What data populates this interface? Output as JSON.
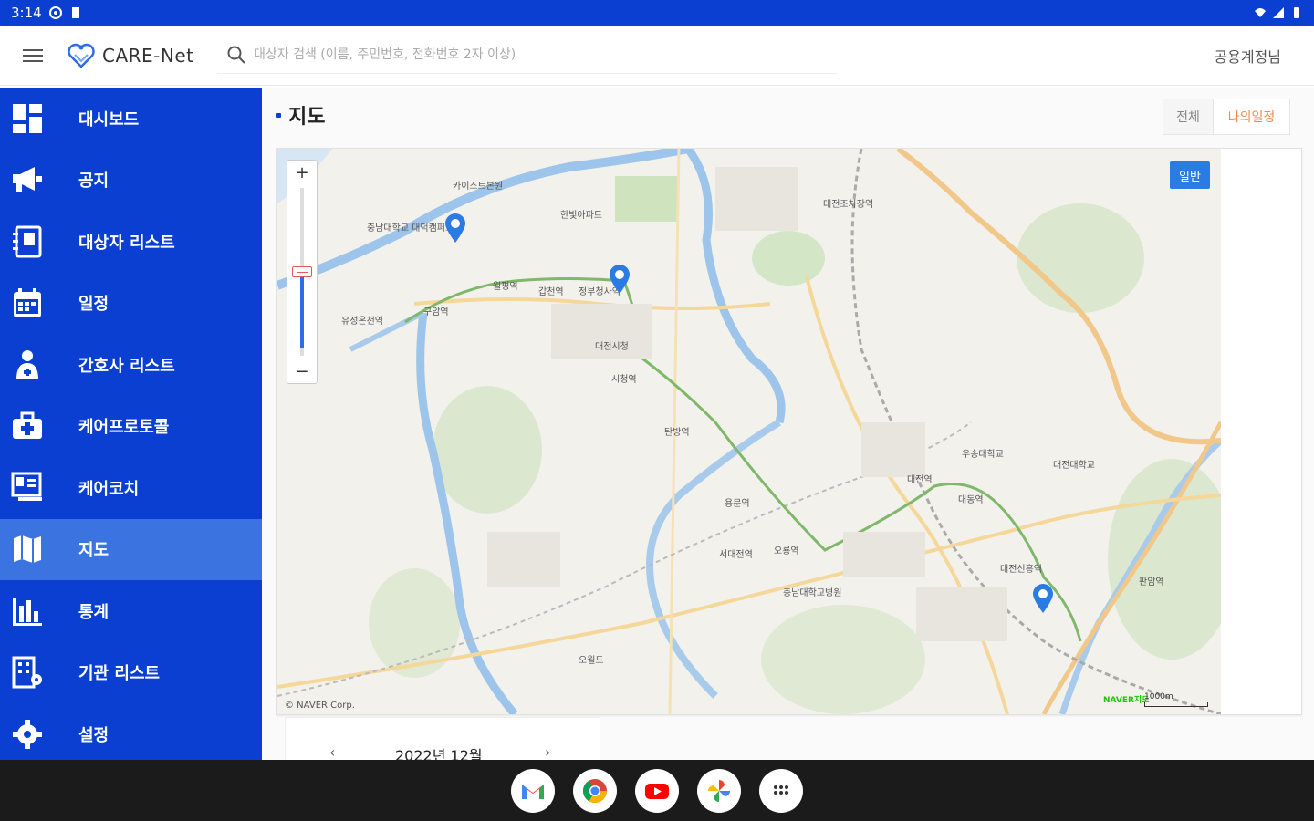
{
  "status_bar": {
    "time": "3:14"
  },
  "app_bar": {
    "brand": "CARE-Net",
    "search_placeholder": "대상자 검색 (이름, 주민번호, 전화번호 2자 이상)",
    "user": "공용계정님"
  },
  "sidebar": {
    "items": [
      {
        "label": "대시보드",
        "icon": "dashboard-icon"
      },
      {
        "label": "공지",
        "icon": "megaphone-icon"
      },
      {
        "label": "대상자 리스트",
        "icon": "contacts-icon"
      },
      {
        "label": "일정",
        "icon": "calendar-icon"
      },
      {
        "label": "간호사 리스트",
        "icon": "nurse-icon"
      },
      {
        "label": "케어프로토콜",
        "icon": "medical-kit-icon"
      },
      {
        "label": "케어코치",
        "icon": "coach-board-icon"
      },
      {
        "label": "지도",
        "icon": "map-icon",
        "active": true
      },
      {
        "label": "통계",
        "icon": "bar-chart-icon"
      },
      {
        "label": "기관 리스트",
        "icon": "building-icon"
      },
      {
        "label": "설정",
        "icon": "gear-icon"
      }
    ]
  },
  "main": {
    "title": "지도",
    "filters": {
      "all": "전체",
      "mine": "나의일정",
      "active": "mine"
    },
    "map": {
      "map_type": "일반",
      "copyright": "© NAVER Corp.",
      "scale": "1000m",
      "naver_logo": "NAVER지도",
      "zoom_in": "+",
      "zoom_out": "−",
      "zoom_level_fraction": 0.45,
      "labels": [
        "카이스트본원",
        "충남대학교 대덕캠퍼스",
        "한빛아파트",
        "유성온천역",
        "구암역",
        "정부청사역",
        "월평역",
        "갑천역",
        "대전시청",
        "시청역",
        "탄방역",
        "용문역",
        "오룡역",
        "서대전역",
        "대전역",
        "대동역",
        "대전대학교",
        "우송대학교",
        "충남대학교병원",
        "오월드",
        "대전신흥역",
        "대전조차장역",
        "판암역"
      ],
      "markers": 3
    },
    "calendar": {
      "month": "2022년 12월",
      "prev": "‹",
      "next": "›"
    }
  },
  "dock": [
    "gmail-icon",
    "chrome-icon",
    "youtube-icon",
    "photos-icon",
    "apps-icon"
  ],
  "colors": {
    "primary": "#0a3fd1",
    "active_nav": "#3b73e0",
    "accent_orange": "#f08a4b",
    "map_marker": "#2b7be5"
  }
}
